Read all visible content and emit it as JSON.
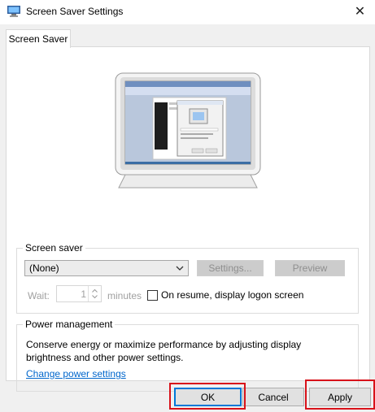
{
  "window": {
    "title": "Screen Saver Settings",
    "close_glyph": "✕"
  },
  "tabs": [
    {
      "label": "Screen Saver",
      "active": true
    }
  ],
  "screen_saver": {
    "group_label": "Screen saver",
    "selected": "(None)",
    "settings_label": "Settings...",
    "preview_label": "Preview",
    "wait_label": "Wait:",
    "wait_value": "1",
    "minutes_label": "minutes",
    "resume_label": "On resume, display logon screen",
    "resume_checked": false
  },
  "power": {
    "group_label": "Power management",
    "description": "Conserve energy or maximize performance by adjusting display brightness and other power settings.",
    "link_label": "Change power settings"
  },
  "buttons": {
    "ok": "OK",
    "cancel": "Cancel",
    "apply": "Apply"
  },
  "colors": {
    "accent": "#0078d7",
    "link": "#0066cc",
    "highlight": "#d8121a"
  }
}
